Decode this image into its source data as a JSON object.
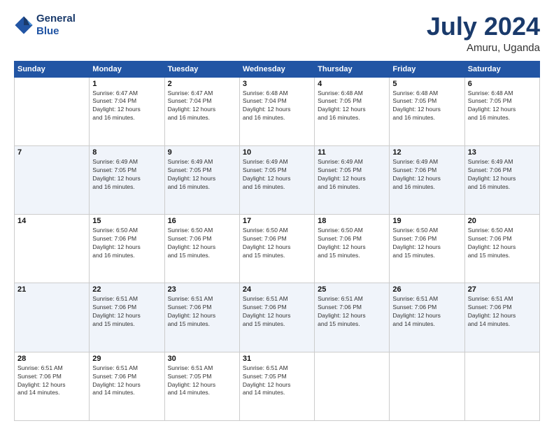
{
  "logo": {
    "line1": "General",
    "line2": "Blue"
  },
  "title": "July 2024",
  "location": "Amuru, Uganda",
  "days_of_week": [
    "Sunday",
    "Monday",
    "Tuesday",
    "Wednesday",
    "Thursday",
    "Friday",
    "Saturday"
  ],
  "weeks": [
    [
      {
        "day": "",
        "info": ""
      },
      {
        "day": "1",
        "info": "Sunrise: 6:47 AM\nSunset: 7:04 PM\nDaylight: 12 hours\nand 16 minutes."
      },
      {
        "day": "2",
        "info": "Sunrise: 6:47 AM\nSunset: 7:04 PM\nDaylight: 12 hours\nand 16 minutes."
      },
      {
        "day": "3",
        "info": "Sunrise: 6:48 AM\nSunset: 7:04 PM\nDaylight: 12 hours\nand 16 minutes."
      },
      {
        "day": "4",
        "info": "Sunrise: 6:48 AM\nSunset: 7:05 PM\nDaylight: 12 hours\nand 16 minutes."
      },
      {
        "day": "5",
        "info": "Sunrise: 6:48 AM\nSunset: 7:05 PM\nDaylight: 12 hours\nand 16 minutes."
      },
      {
        "day": "6",
        "info": "Sunrise: 6:48 AM\nSunset: 7:05 PM\nDaylight: 12 hours\nand 16 minutes."
      }
    ],
    [
      {
        "day": "7",
        "info": ""
      },
      {
        "day": "8",
        "info": "Sunrise: 6:49 AM\nSunset: 7:05 PM\nDaylight: 12 hours\nand 16 minutes."
      },
      {
        "day": "9",
        "info": "Sunrise: 6:49 AM\nSunset: 7:05 PM\nDaylight: 12 hours\nand 16 minutes."
      },
      {
        "day": "10",
        "info": "Sunrise: 6:49 AM\nSunset: 7:05 PM\nDaylight: 12 hours\nand 16 minutes."
      },
      {
        "day": "11",
        "info": "Sunrise: 6:49 AM\nSunset: 7:05 PM\nDaylight: 12 hours\nand 16 minutes."
      },
      {
        "day": "12",
        "info": "Sunrise: 6:49 AM\nSunset: 7:06 PM\nDaylight: 12 hours\nand 16 minutes."
      },
      {
        "day": "13",
        "info": "Sunrise: 6:49 AM\nSunset: 7:06 PM\nDaylight: 12 hours\nand 16 minutes."
      }
    ],
    [
      {
        "day": "14",
        "info": ""
      },
      {
        "day": "15",
        "info": "Sunrise: 6:50 AM\nSunset: 7:06 PM\nDaylight: 12 hours\nand 16 minutes."
      },
      {
        "day": "16",
        "info": "Sunrise: 6:50 AM\nSunset: 7:06 PM\nDaylight: 12 hours\nand 15 minutes."
      },
      {
        "day": "17",
        "info": "Sunrise: 6:50 AM\nSunset: 7:06 PM\nDaylight: 12 hours\nand 15 minutes."
      },
      {
        "day": "18",
        "info": "Sunrise: 6:50 AM\nSunset: 7:06 PM\nDaylight: 12 hours\nand 15 minutes."
      },
      {
        "day": "19",
        "info": "Sunrise: 6:50 AM\nSunset: 7:06 PM\nDaylight: 12 hours\nand 15 minutes."
      },
      {
        "day": "20",
        "info": "Sunrise: 6:50 AM\nSunset: 7:06 PM\nDaylight: 12 hours\nand 15 minutes."
      }
    ],
    [
      {
        "day": "21",
        "info": ""
      },
      {
        "day": "22",
        "info": "Sunrise: 6:51 AM\nSunset: 7:06 PM\nDaylight: 12 hours\nand 15 minutes."
      },
      {
        "day": "23",
        "info": "Sunrise: 6:51 AM\nSunset: 7:06 PM\nDaylight: 12 hours\nand 15 minutes."
      },
      {
        "day": "24",
        "info": "Sunrise: 6:51 AM\nSunset: 7:06 PM\nDaylight: 12 hours\nand 15 minutes."
      },
      {
        "day": "25",
        "info": "Sunrise: 6:51 AM\nSunset: 7:06 PM\nDaylight: 12 hours\nand 15 minutes."
      },
      {
        "day": "26",
        "info": "Sunrise: 6:51 AM\nSunset: 7:06 PM\nDaylight: 12 hours\nand 14 minutes."
      },
      {
        "day": "27",
        "info": "Sunrise: 6:51 AM\nSunset: 7:06 PM\nDaylight: 12 hours\nand 14 minutes."
      }
    ],
    [
      {
        "day": "28",
        "info": "Sunrise: 6:51 AM\nSunset: 7:06 PM\nDaylight: 12 hours\nand 14 minutes."
      },
      {
        "day": "29",
        "info": "Sunrise: 6:51 AM\nSunset: 7:06 PM\nDaylight: 12 hours\nand 14 minutes."
      },
      {
        "day": "30",
        "info": "Sunrise: 6:51 AM\nSunset: 7:05 PM\nDaylight: 12 hours\nand 14 minutes."
      },
      {
        "day": "31",
        "info": "Sunrise: 6:51 AM\nSunset: 7:05 PM\nDaylight: 12 hours\nand 14 minutes."
      },
      {
        "day": "",
        "info": ""
      },
      {
        "day": "",
        "info": ""
      },
      {
        "day": "",
        "info": ""
      }
    ]
  ]
}
